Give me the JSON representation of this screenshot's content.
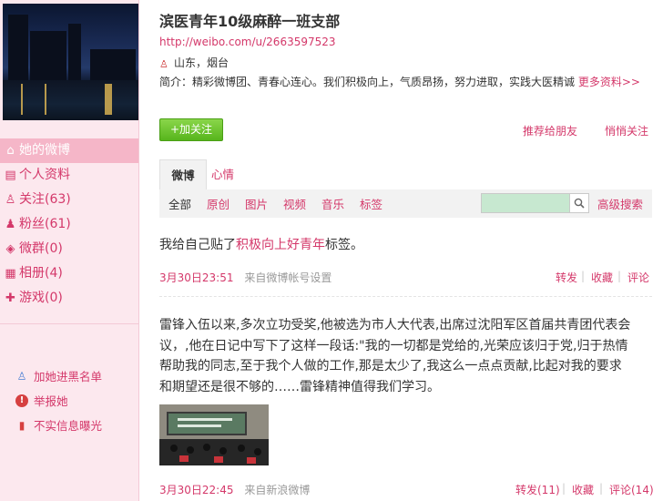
{
  "profile": {
    "name": "滨医青年10级麻醉一班支部",
    "url": "http://weibo.com/u/2663597523",
    "location": "山东，烟台",
    "intro": "简介：精彩微博团、青春心连心。我们积极向上，气质昂扬，努力进取，实践大医精诚",
    "more_link": "更多资料>>",
    "follow_button": "+加关注",
    "recommend_link": "推荐给朋友",
    "whisper_link": "悄悄关注"
  },
  "sidebar": {
    "nav": [
      {
        "label": "她的微博",
        "icon": "home-icon"
      },
      {
        "label": "个人资料",
        "icon": "profile-card-icon"
      },
      {
        "label": "关注(63)",
        "icon": "user-icon"
      },
      {
        "label": "粉丝(61)",
        "icon": "users-icon"
      },
      {
        "label": "微群(0)",
        "icon": "group-icon"
      },
      {
        "label": "相册(4)",
        "icon": "album-icon"
      },
      {
        "label": "游戏(0)",
        "icon": "game-icon"
      }
    ],
    "links": [
      {
        "label": "加她进黑名单",
        "icon": "block-user-icon"
      },
      {
        "label": "举报她",
        "icon": "report-icon"
      },
      {
        "label": "不实信息曝光",
        "icon": "rumor-icon"
      }
    ]
  },
  "tabs": [
    "微博",
    "心情"
  ],
  "filters": [
    "全部",
    "原创",
    "图片",
    "视频",
    "音乐",
    "标签"
  ],
  "search": {
    "placeholder": "",
    "advanced": "高级搜索"
  },
  "posts": [
    {
      "prefix": "我给自己贴了",
      "tag": "积极向上好青年",
      "suffix": "标签。",
      "date": "3月30日23:51",
      "source": "来自微博帐号设置",
      "repost": "转发",
      "favorite": "收藏",
      "comment": "评论"
    },
    {
      "text": "雷锋入伍以来,多次立功受奖,他被选为市人大代表,出席过沈阳军区首届共青团代表会议，,他在日记中写下了这样一段话:\"我的一切都是党给的,光荣应该归于党,归于热情帮助我的同志,至于我个人做的工作,那是太少了,我这么一点点贡献,比起对我的要求和期望还是很不够的……雷锋精神值得我们学习。",
      "date": "3月30日22:45",
      "source": "来自新浪微博",
      "repost": "转发(11)",
      "favorite": "收藏",
      "comment": "评论(14)"
    }
  ],
  "colors": {
    "accent": "#d4386a",
    "sidebar_bg": "#fce8ee",
    "active_nav": "#f5b6c8",
    "follow_green": "#57b51c"
  }
}
